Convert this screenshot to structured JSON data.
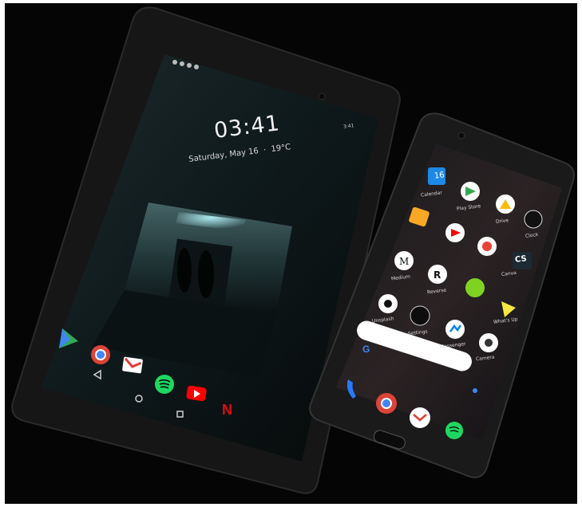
{
  "tablet": {
    "lock_time": "03:41",
    "lock_date": "Saturday, May 16",
    "lock_temp": "19°C",
    "status_time": "3:41",
    "dock_apps": [
      "play-store",
      "chrome",
      "gmail",
      "spotify",
      "youtube",
      "netflix"
    ]
  },
  "phone": {
    "calendar_day": "16",
    "apps": {
      "calendar": "Calendar",
      "play_store": "Play Store",
      "drive": "Drive",
      "clock": "Clock",
      "medium": "Medium",
      "reverse": "Reverse",
      "unsplash": "Unsplash",
      "settings": "Settings",
      "messenger": "Messenger",
      "whats_up": "What's Up",
      "camera": "Camera",
      "canva": "Canva",
      "cs": "CS"
    },
    "dock_apps": [
      "phone",
      "chrome",
      "gmail",
      "spotify"
    ]
  },
  "colors": {
    "background": "#050505",
    "tablet_body": "#161616",
    "phone_body": "#1a1a1a",
    "accent_red": "#e53935",
    "spotify_green": "#1ed760",
    "youtube_red": "#ff0000",
    "netflix_red": "#e50914"
  }
}
